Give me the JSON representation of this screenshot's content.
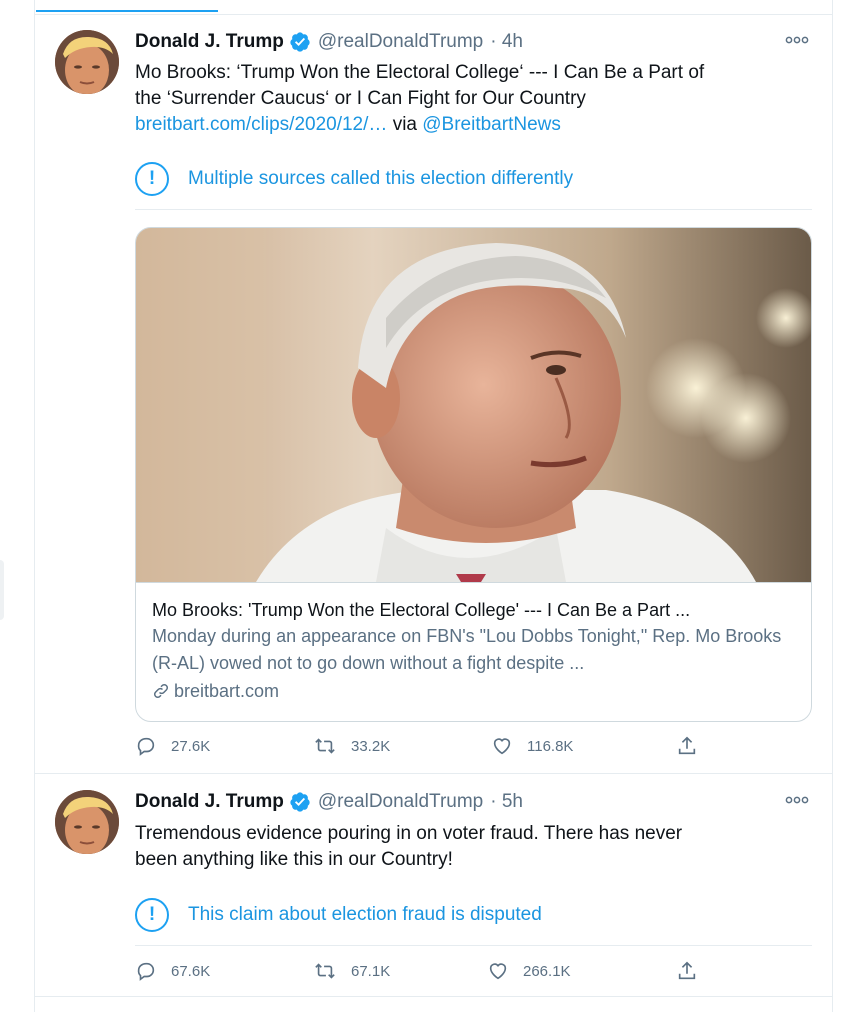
{
  "tweets": [
    {
      "author_name": "Donald J. Trump",
      "handle": "@realDonaldTrump",
      "time": "· 4h",
      "text_line1": "Mo Brooks: ‘Trump Won the Electoral College‘ --- I Can Be a Part of",
      "text_line2": "the ‘Surrender Caucus‘ or I Can Fight for Our Country",
      "link_text": "breitbart.com/clips/2020/12/…",
      "via_text": "via",
      "via_handle": "@BreitbartNews",
      "notice": "Multiple sources called this election differently",
      "card": {
        "title": "Mo Brooks: 'Trump Won the Electoral College' --- I Can Be a Part ...",
        "description": "Monday during an appearance on FBN's \"Lou Dobbs Tonight,\" Rep. Mo Brooks (R-AL) vowed not to go down without a fight despite ...",
        "domain": "breitbart.com"
      },
      "replies": "27.6K",
      "retweets": "33.2K",
      "likes": "116.8K"
    },
    {
      "author_name": "Donald J. Trump",
      "handle": "@realDonaldTrump",
      "time": "· 5h",
      "text_line1": "Tremendous evidence pouring in on voter fraud. There has never",
      "text_line2": "been anything like this in our Country!",
      "notice": "This claim about election fraud is disputed",
      "replies": "67.6K",
      "retweets": "67.1K",
      "likes": "266.1K"
    }
  ],
  "icons": {
    "verified": "verified-badge-icon",
    "more": "more-options-icon",
    "notice": "exclamation-icon",
    "reply": "reply-icon",
    "retweet": "retweet-icon",
    "like": "heart-icon",
    "share": "share-icon",
    "link": "link-icon"
  },
  "colors": {
    "accent": "#1da1f2",
    "link": "#1b95e0",
    "secondary_text": "#5b7083",
    "border": "#e6ecf0"
  }
}
